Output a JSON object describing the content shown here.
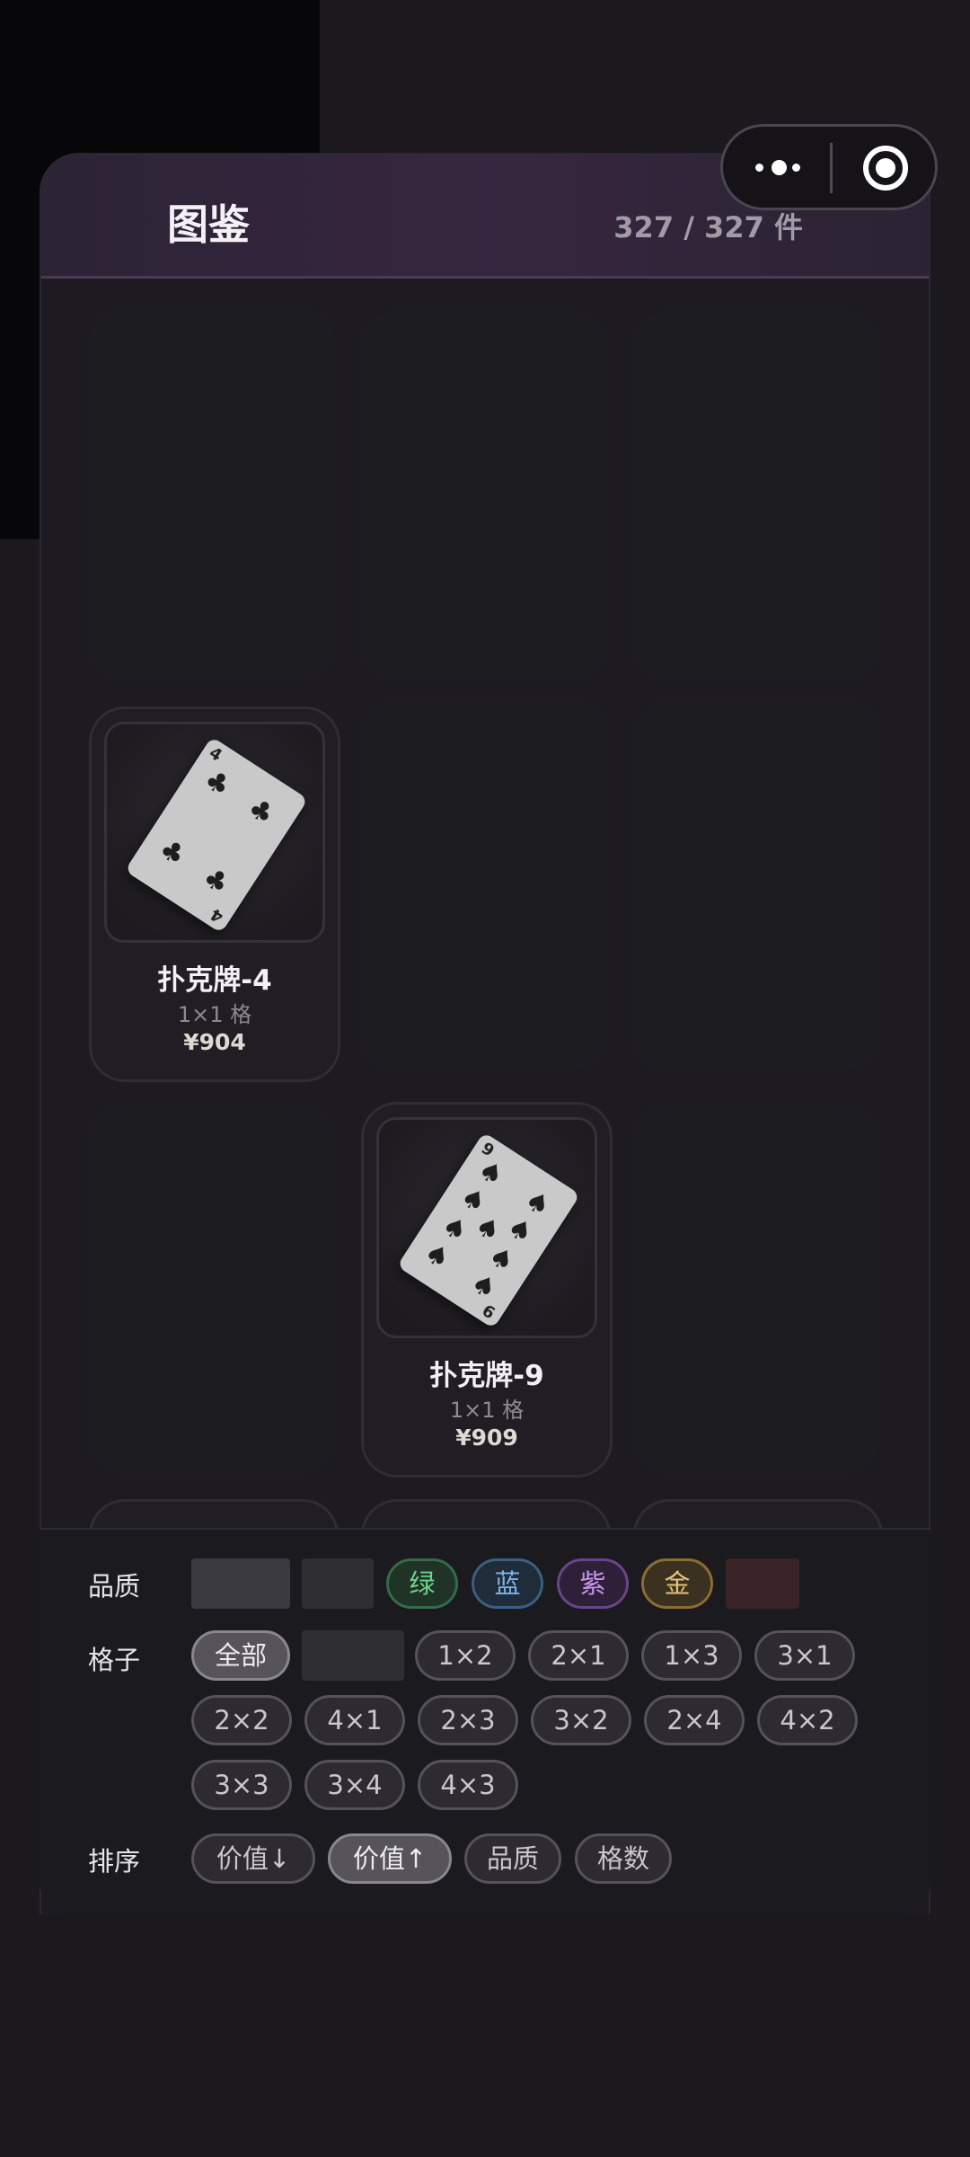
{
  "header": {
    "title": "图鉴",
    "count": "327 / 327 件"
  },
  "capsule": {
    "more_icon": "more-dots-icon",
    "close_icon": "target-close-icon"
  },
  "cards": [
    {
      "name": "扑克牌-4",
      "size": "1×1 格",
      "price": "¥904",
      "rank": "4",
      "suit": "♣",
      "suit_name": "clubs"
    },
    {
      "name": "扑克牌-9",
      "size": "1×1 格",
      "price": "¥909",
      "rank": "9",
      "suit": "♠",
      "suit_name": "spades"
    }
  ],
  "filters": {
    "quality": {
      "label": "品质",
      "options": [
        {
          "label": "",
          "style": "swatch",
          "color": "#3c3a41"
        },
        {
          "label": "",
          "style": "swatch",
          "color": "#2f2e33"
        },
        {
          "label": "绿",
          "style": "green"
        },
        {
          "label": "蓝",
          "style": "blue"
        },
        {
          "label": "紫",
          "style": "purple"
        },
        {
          "label": "金",
          "style": "gold"
        },
        {
          "label": "",
          "style": "swatch",
          "color": "#3a2327"
        }
      ]
    },
    "grid": {
      "label": "格子",
      "options": [
        "全部",
        "",
        "1×2",
        "2×1",
        "1×3",
        "3×1",
        "2×2",
        "4×1",
        "2×3",
        "3×2",
        "2×4",
        "4×2",
        "3×3",
        "3×4",
        "4×3"
      ],
      "active": "全部"
    },
    "sort": {
      "label": "排序",
      "options": [
        "价值↓",
        "价值↑",
        "品质",
        "格数"
      ],
      "active": "价值↑"
    }
  }
}
